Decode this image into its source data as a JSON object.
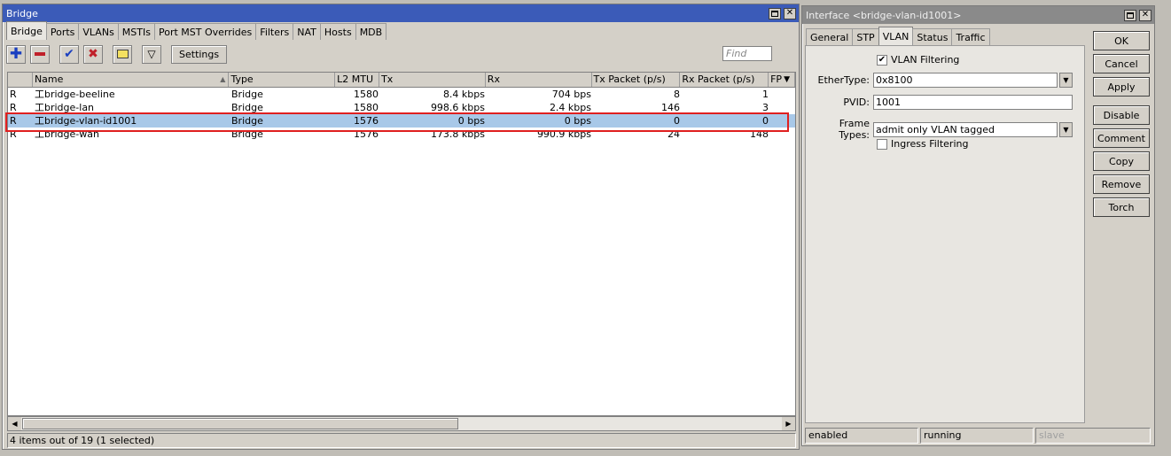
{
  "bridge_window": {
    "title": "Bridge",
    "tabs": [
      "Bridge",
      "Ports",
      "VLANs",
      "MSTIs",
      "Port MST Overrides",
      "Filters",
      "NAT",
      "Hosts",
      "MDB"
    ],
    "toolbar": {
      "add": "add-icon",
      "remove": "remove-icon",
      "enable": "check-icon",
      "disable": "x-icon",
      "comment": "comment-icon",
      "filter": "filter-icon",
      "settings_label": "Settings",
      "find_placeholder": "Find"
    },
    "columns": [
      "",
      "Name",
      "Type",
      "L2 MTU",
      "Tx",
      "Rx",
      "Tx Packet (p/s)",
      "Rx Packet (p/s)",
      "FP"
    ],
    "rows": [
      {
        "flag": "R",
        "name": "bridge-beeline",
        "type": "Bridge",
        "l2mtu": "1580",
        "tx": "8.4 kbps",
        "rx": "704 bps",
        "txp": "8",
        "rxp": "1"
      },
      {
        "flag": "R",
        "name": "bridge-lan",
        "type": "Bridge",
        "l2mtu": "1580",
        "tx": "998.6 kbps",
        "rx": "2.4 kbps",
        "txp": "146",
        "rxp": "3"
      },
      {
        "flag": "R",
        "name": "bridge-vlan-id1001",
        "type": "Bridge",
        "l2mtu": "1576",
        "tx": "0 bps",
        "rx": "0 bps",
        "txp": "0",
        "rxp": "0"
      },
      {
        "flag": "R",
        "name": "bridge-wan",
        "type": "Bridge",
        "l2mtu": "1576",
        "tx": "173.8 kbps",
        "rx": "990.9 kbps",
        "txp": "24",
        "rxp": "148"
      }
    ],
    "selected_row": 2,
    "status": "4 items out of 19 (1 selected)"
  },
  "interface_window": {
    "title": "Interface <bridge-vlan-id1001>",
    "tabs": [
      "General",
      "STP",
      "VLAN",
      "Status",
      "Traffic"
    ],
    "active_tab": "VLAN",
    "vlan_filtering_label": "VLAN Filtering",
    "vlan_filtering_checked": true,
    "ethertype_label": "EtherType:",
    "ethertype_value": "0x8100",
    "pvid_label": "PVID:",
    "pvid_value": "1001",
    "frame_types_label": "Frame Types:",
    "frame_types_value": "admit only VLAN tagged",
    "ingress_filtering_label": "Ingress Filtering",
    "ingress_filtering_checked": false,
    "buttons": {
      "ok": "OK",
      "cancel": "Cancel",
      "apply": "Apply",
      "disable": "Disable",
      "comment": "Comment",
      "copy": "Copy",
      "remove": "Remove",
      "torch": "Torch"
    },
    "status": {
      "enabled": "enabled",
      "running": "running",
      "slave": "slave"
    }
  },
  "colors": {
    "active_title": "#3b5bb8",
    "selected_row": "#a8c8e8",
    "highlight_box": "#e02020"
  }
}
